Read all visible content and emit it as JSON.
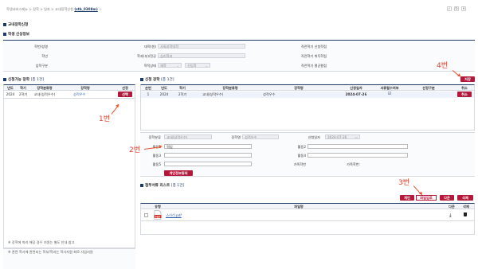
{
  "breadcrumb": {
    "text": "학생서비스메뉴 > 장학 > 일자 > 교내장학신청",
    "code": "(stb_0308m)",
    "star": "☆"
  },
  "top_icons": [
    "✓",
    "↻",
    "✕"
  ],
  "page_title": "교내장학신청",
  "student_info": {
    "title": "학생 신상정보",
    "labels": {
      "student_no_name": "학번/성명",
      "grade": "학년",
      "enroll_type": "입학구분",
      "college": "대학(원)",
      "major": "학과(부)/전공",
      "status": "학적상태",
      "prev_gpa": "직전학기 신청학점",
      "prev_earned": "직전학기 취득학점",
      "prev_avg": "직전학기 평균평점"
    },
    "values": {
      "college": "사회과학대학",
      "major": "심리학과",
      "status": "재학",
      "status_sub": "신입학"
    }
  },
  "available": {
    "title": "신청가능 장학",
    "count": "[총 1건]",
    "headers": [
      "년도",
      "학기",
      "장학분류명",
      "장학명",
      "선정"
    ],
    "rows": [
      {
        "year": "2024",
        "term": "2학기",
        "category": "교내(성적우수)",
        "name": "성적우수",
        "select": "선택"
      }
    ],
    "notice": "※ 장학에 따라 해당 경우 지원는 별도 안내 참고",
    "notice2": "※ 관련 학사에 관련되는 학부/학과는 학사지원 파로 사업지원"
  },
  "applied": {
    "title": "신청 장학",
    "count": "[총 1건]",
    "headers": [
      "순번",
      "년도",
      "학기",
      "장학분류명",
      "장학명",
      "신청일자",
      "서류필수여부",
      "선정구분",
      "취소"
    ],
    "rows": [
      {
        "no": "1",
        "year": "2024",
        "term": "2학기",
        "category": "교내(성적우수)",
        "name": "성적우수",
        "date": "2024-07-26",
        "doc": "☑",
        "sel": "",
        "cancel": "취소"
      }
    ],
    "save_label": "저장"
  },
  "detail": {
    "category_label": "장학분류",
    "category_value": "교내(성적우수)",
    "name_label": "장학명",
    "name_value": "성적우수",
    "date_label": "신청일자",
    "date_value": "2024-07-26",
    "act1_label": "활동1",
    "act1_value": "뭐임",
    "act2_label": "활동2",
    "act3_label": "활동3",
    "act4_label": "활동4",
    "act5_label": "활동5",
    "family_label": "가족학번",
    "family_name_label": "가족학번:",
    "privacy_btn": "개인정보동의"
  },
  "attachments": {
    "title": "첨부서류 리스트",
    "count": "[총 1건]",
    "buttons": [
      "개인",
      "파일업로",
      "다운",
      "삭제"
    ],
    "headers": [
      "",
      "유형",
      "파일명",
      "다운",
      "삭제"
    ],
    "files": [
      {
        "name": "스터디.pdf"
      }
    ]
  },
  "annotations": {
    "a1": "1번",
    "a2": "2번",
    "a3": "3번",
    "a4": "4번"
  },
  "colors": {
    "accent": "#b4193b",
    "navy": "#1e3a66",
    "annotation": "#e63c2a"
  }
}
